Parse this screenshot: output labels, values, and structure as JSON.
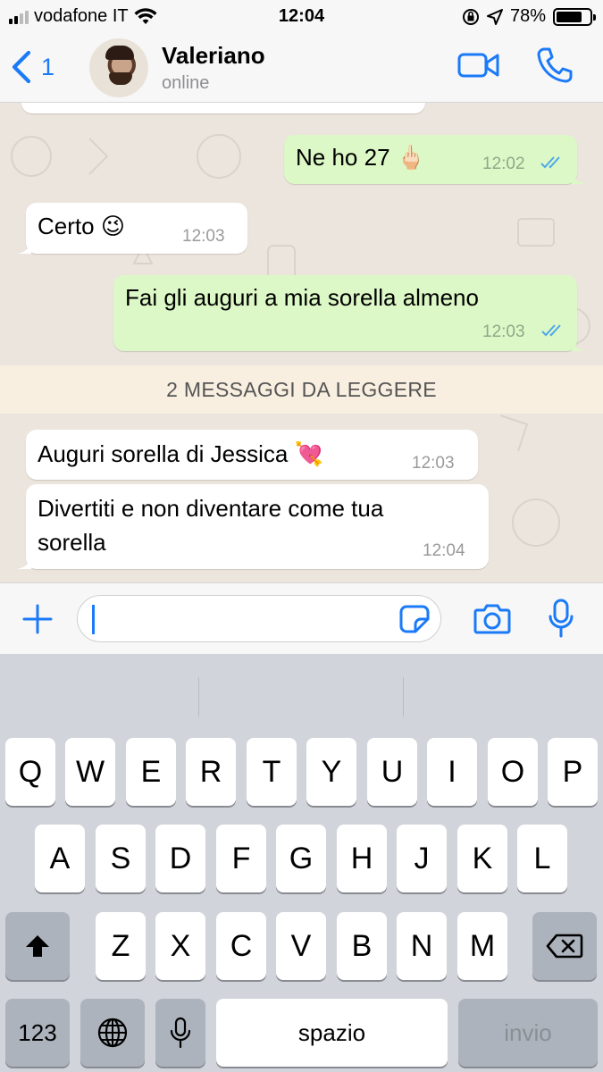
{
  "status_bar": {
    "carrier": "vodafone IT",
    "time": "12:04",
    "battery_percent": "78%",
    "battery_level": 0.78
  },
  "header": {
    "back_label": "1",
    "contact_name": "Valeriano",
    "contact_status": "online"
  },
  "chat": {
    "messages": [
      {
        "direction": "out",
        "text": "Ne ho 27",
        "emoji": "🖕🏻",
        "time": "12:02",
        "read": true
      },
      {
        "direction": "in",
        "text": "Certo",
        "emoji": "😉",
        "time": "12:03"
      },
      {
        "direction": "out",
        "text": "Fai gli auguri a mia sorella almeno",
        "time": "12:03",
        "read": true
      },
      {
        "direction": "in",
        "text": "Auguri sorella di Jessica",
        "emoji": "💘",
        "time": "12:03"
      },
      {
        "direction": "in",
        "text_line1": "Divertiti e non diventare come tua",
        "text_line2": "sorella",
        "time": "12:04"
      }
    ],
    "unread_banner": "2 MESSAGGI DA LEGGERE"
  },
  "input": {
    "value": "",
    "placeholder": ""
  },
  "keyboard": {
    "row1": [
      "Q",
      "W",
      "E",
      "R",
      "T",
      "Y",
      "U",
      "I",
      "O",
      "P"
    ],
    "row2": [
      "A",
      "S",
      "D",
      "F",
      "G",
      "H",
      "J",
      "K",
      "L"
    ],
    "row3": [
      "Z",
      "X",
      "C",
      "V",
      "B",
      "N",
      "M"
    ],
    "numbers_key": "123",
    "space_key": "spazio",
    "return_key": "invio"
  },
  "colors": {
    "accent": "#1A7AF8",
    "outgoing_bubble": "#DCF8C6",
    "incoming_bubble": "#FFFFFF",
    "chat_background": "#ECE5DD"
  }
}
